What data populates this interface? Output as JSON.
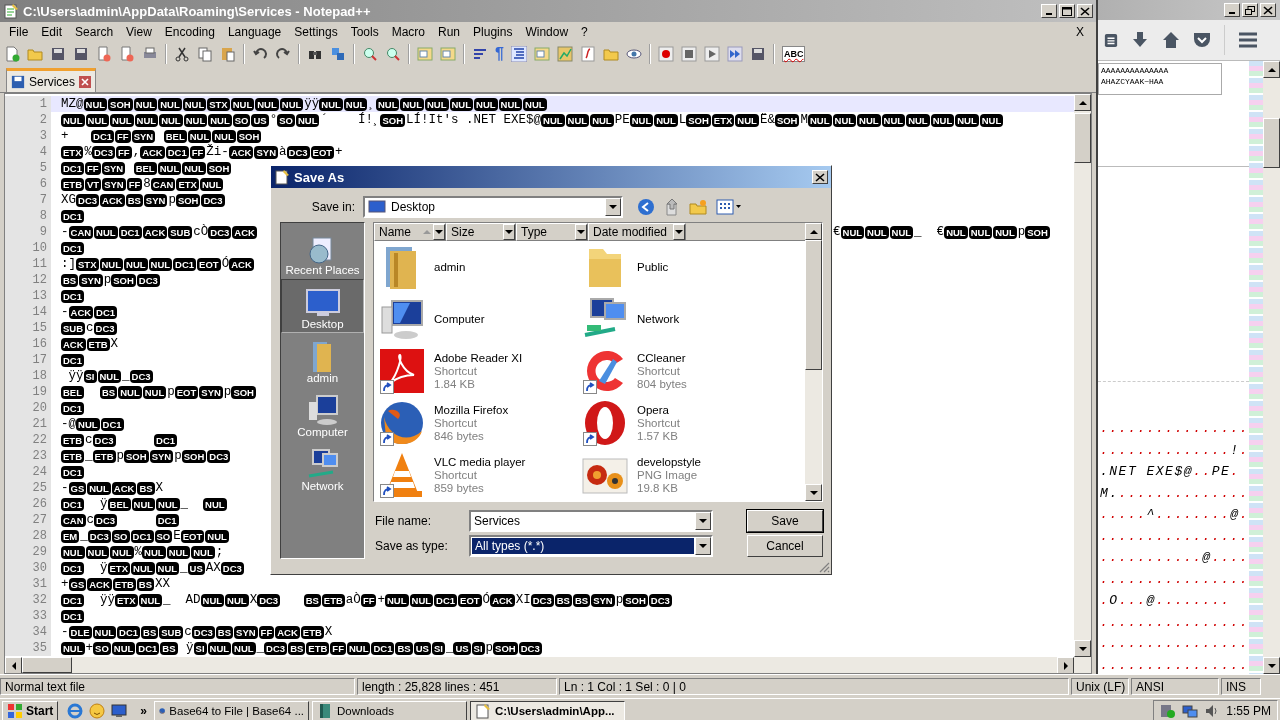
{
  "notepad": {
    "title": "C:\\Users\\admin\\AppData\\Roaming\\Services - Notepad++",
    "active": false,
    "menu": [
      "File",
      "Edit",
      "Search",
      "View",
      "Encoding",
      "Language",
      "Settings",
      "Tools",
      "Macro",
      "Run",
      "Plugins",
      "Window",
      "?"
    ],
    "menu_close": "X",
    "pilcrow": "¶",
    "spellcheck": "ABC",
    "tabs": [
      {
        "label": "Services",
        "selected": true
      }
    ],
    "lines": [
      {
        "number": "1",
        "current": true,
        "segments": [
          {
            "kind": "text",
            "text": "MZ@"
          },
          {
            "kind": "ctrl",
            "codes": [
              "NUL",
              "SOH",
              "NUL",
              "NUL",
              "NUL",
              "STX",
              "NUL",
              "NUL",
              "NUL"
            ]
          },
          {
            "kind": "text",
            "text": "ÿÿ"
          },
          {
            "kind": "ctrl",
            "codes": [
              "NUL",
              "NUL"
            ]
          },
          {
            "kind": "text",
            "text": "¸"
          },
          {
            "kind": "ctrl",
            "codes": [
              "NUL",
              "NUL",
              "NUL",
              "NUL",
              "NUL",
              "NUL",
              "NUL"
            ]
          }
        ]
      },
      {
        "number": "2",
        "current": false,
        "segments": [
          {
            "kind": "ctrl",
            "codes": [
              "NUL",
              "NUL",
              "NUL",
              "NUL",
              "NUL",
              "NUL",
              "NUL",
              "SO",
              "US"
            ]
          },
          {
            "kind": "text",
            "text": "°"
          },
          {
            "kind": "ctrl",
            "codes": [
              "SO",
              "NUL"
            ]
          },
          {
            "kind": "text",
            "text": "´    Í!¸"
          },
          {
            "kind": "ctrl",
            "codes": [
              "SOH"
            ]
          },
          {
            "kind": "text",
            "text": "LÍ!It's .NET EXE$@"
          },
          {
            "kind": "ctrl",
            "codes": [
              "NUL",
              "NUL",
              "NUL"
            ]
          },
          {
            "kind": "text",
            "text": "PE"
          },
          {
            "kind": "ctrl",
            "codes": [
              "NUL",
              "NUL"
            ]
          },
          {
            "kind": "text",
            "text": "L"
          },
          {
            "kind": "ctrl",
            "codes": [
              "SOH",
              "ETX",
              "NUL"
            ]
          },
          {
            "kind": "text",
            "text": "Ë&"
          },
          {
            "kind": "ctrl",
            "codes": [
              "SOH"
            ]
          },
          {
            "kind": "text",
            "text": "M"
          },
          {
            "kind": "ctrl",
            "codes": [
              "NUL",
              "NUL",
              "NUL",
              "NUL",
              "NUL",
              "NUL",
              "NUL",
              "NUL"
            ]
          }
        ]
      },
      {
        "number": "3",
        "current": false,
        "segments": [
          {
            "kind": "text",
            "text": "+   "
          },
          {
            "kind": "ctrl",
            "codes": [
              "DC1",
              "FF",
              "SYN"
            ]
          },
          {
            "kind": "space"
          },
          {
            "kind": "ctrl",
            "codes": [
              "BEL",
              "NUL",
              "NUL",
              "SOH"
            ]
          }
        ]
      },
      {
        "number": "4",
        "current": false,
        "segments": [
          {
            "kind": "ctrl",
            "codes": [
              "ETX"
            ]
          },
          {
            "kind": "text",
            "text": "%"
          },
          {
            "kind": "ctrl",
            "codes": [
              "DC3",
              "FF"
            ]
          },
          {
            "kind": "text",
            "text": ","
          },
          {
            "kind": "ctrl",
            "codes": [
              "ACK",
              "DC1",
              "FF"
            ]
          },
          {
            "kind": "text",
            "text": "Ži-"
          },
          {
            "kind": "ctrl",
            "codes": [
              "ACK",
              "SYN"
            ]
          },
          {
            "kind": "text",
            "text": "à"
          },
          {
            "kind": "ctrl",
            "codes": [
              "DC3",
              "EOT"
            ]
          },
          {
            "kind": "text",
            "text": "+"
          }
        ]
      },
      {
        "number": "5",
        "current": false,
        "segments": [
          {
            "kind": "ctrl",
            "codes": [
              "DC1",
              "FF",
              "SYN"
            ]
          },
          {
            "kind": "space"
          },
          {
            "kind": "ctrl",
            "codes": [
              "BEL",
              "NUL",
              "NUL",
              "SOH"
            ]
          }
        ]
      },
      {
        "number": "6",
        "current": false,
        "segments": [
          {
            "kind": "ctrl",
            "codes": [
              "ETB",
              "VT",
              "SYN",
              "FF"
            ]
          },
          {
            "kind": "text",
            "text": "8"
          },
          {
            "kind": "ctrl",
            "codes": [
              "CAN",
              "ETX",
              "NUL"
            ]
          }
        ]
      },
      {
        "number": "7",
        "current": false,
        "segments": [
          {
            "kind": "text",
            "text": "XG"
          },
          {
            "kind": "ctrl",
            "codes": [
              "DC3",
              "ACK",
              "BS",
              "SYN"
            ]
          },
          {
            "kind": "text",
            "text": "p"
          },
          {
            "kind": "ctrl",
            "codes": [
              "SOH",
              "DC3"
            ]
          }
        ]
      },
      {
        "number": "8",
        "current": false,
        "segments": [
          {
            "kind": "ctrl",
            "codes": [
              "DC1"
            ]
          }
        ]
      },
      {
        "number": "9",
        "current": false,
        "segments": [
          {
            "kind": "text",
            "text": "-"
          },
          {
            "kind": "ctrl",
            "codes": [
              "CAN",
              "NUL",
              "DC1",
              "ACK",
              "SUB"
            ]
          },
          {
            "kind": "text",
            "text": "cÒ"
          },
          {
            "kind": "ctrl",
            "codes": [
              "DC3",
              "ACK"
            ]
          }
        ],
        "right_segments": [
          {
            "kind": "text",
            "text": "€"
          },
          {
            "kind": "ctrl",
            "codes": [
              "NUL",
              "NUL",
              "NUL"
            ]
          },
          {
            "kind": "text",
            "text": "_  €"
          },
          {
            "kind": "ctrl",
            "codes": [
              "NUL",
              "NUL",
              "NUL"
            ]
          },
          {
            "kind": "text",
            "text": "p"
          },
          {
            "kind": "ctrl",
            "codes": [
              "SOH"
            ]
          }
        ]
      },
      {
        "number": "10",
        "current": false,
        "segments": [
          {
            "kind": "ctrl",
            "codes": [
              "DC1"
            ]
          }
        ]
      },
      {
        "number": "11",
        "current": false,
        "segments": [
          {
            "kind": "text",
            "text": ":]"
          },
          {
            "kind": "ctrl",
            "codes": [
              "STX",
              "NUL",
              "NUL",
              "NUL",
              "DC1",
              "EOT"
            ]
          },
          {
            "kind": "text",
            "text": "Ó"
          },
          {
            "kind": "ctrl",
            "codes": [
              "ACK"
            ]
          }
        ]
      },
      {
        "number": "12",
        "current": false,
        "segments": [
          {
            "kind": "ctrl",
            "codes": [
              "BS",
              "SYN"
            ]
          },
          {
            "kind": "text",
            "text": "p"
          },
          {
            "kind": "ctrl",
            "codes": [
              "SOH",
              "DC3"
            ]
          }
        ]
      },
      {
        "number": "13",
        "current": false,
        "segments": [
          {
            "kind": "ctrl",
            "codes": [
              "DC1"
            ]
          }
        ]
      },
      {
        "number": "14",
        "current": false,
        "segments": [
          {
            "kind": "text",
            "text": "-"
          },
          {
            "kind": "ctrl",
            "codes": [
              "ACK",
              "DC1"
            ]
          }
        ]
      },
      {
        "number": "15",
        "current": false,
        "segments": [
          {
            "kind": "ctrl",
            "codes": [
              "SUB"
            ]
          },
          {
            "kind": "text",
            "text": "c"
          },
          {
            "kind": "ctrl",
            "codes": [
              "DC3"
            ]
          }
        ]
      },
      {
        "number": "16",
        "current": false,
        "segments": [
          {
            "kind": "ctrl",
            "codes": [
              "ACK",
              "ETB"
            ]
          },
          {
            "kind": "text",
            "text": "X"
          }
        ]
      },
      {
        "number": "17",
        "current": false,
        "segments": [
          {
            "kind": "ctrl",
            "codes": [
              "DC1"
            ]
          }
        ]
      },
      {
        "number": "18",
        "current": false,
        "segments": [
          {
            "kind": "text",
            "text": " ÿÿ"
          },
          {
            "kind": "ctrl",
            "codes": [
              "SI",
              "NUL"
            ]
          },
          {
            "kind": "text",
            "text": "_"
          },
          {
            "kind": "ctrl",
            "codes": [
              "DC3"
            ]
          }
        ]
      },
      {
        "number": "19",
        "current": false,
        "segments": [
          {
            "kind": "ctrl",
            "codes": [
              "BEL"
            ]
          },
          {
            "kind": "space"
          },
          {
            "kind": "space"
          },
          {
            "kind": "ctrl",
            "codes": [
              "BS",
              "NUL",
              "NUL"
            ]
          },
          {
            "kind": "text",
            "text": "p"
          },
          {
            "kind": "ctrl",
            "codes": [
              "EOT",
              "SYN"
            ]
          },
          {
            "kind": "text",
            "text": "p"
          },
          {
            "kind": "ctrl",
            "codes": [
              "SOH"
            ]
          }
        ]
      },
      {
        "number": "20",
        "current": false,
        "segments": [
          {
            "kind": "ctrl",
            "codes": [
              "DC1"
            ]
          }
        ]
      },
      {
        "number": "21",
        "current": false,
        "segments": [
          {
            "kind": "text",
            "text": "-@"
          },
          {
            "kind": "ctrl",
            "codes": [
              "NUL",
              "DC1"
            ]
          }
        ]
      },
      {
        "number": "22",
        "current": false,
        "segments": [
          {
            "kind": "ctrl",
            "codes": [
              "ETB"
            ]
          },
          {
            "kind": "text",
            "text": "c"
          },
          {
            "kind": "ctrl",
            "codes": [
              "DC3"
            ]
          },
          {
            "kind": "space"
          },
          {
            "kind": "space"
          },
          {
            "kind": "space"
          },
          {
            "kind": "space"
          },
          {
            "kind": "space"
          },
          {
            "kind": "ctrl",
            "codes": [
              "DC1"
            ]
          }
        ]
      },
      {
        "number": "23",
        "current": false,
        "segments": [
          {
            "kind": "ctrl",
            "codes": [
              "ETB"
            ]
          },
          {
            "kind": "text",
            "text": "_"
          },
          {
            "kind": "ctrl",
            "codes": [
              "ETB"
            ]
          },
          {
            "kind": "text",
            "text": "p"
          },
          {
            "kind": "ctrl",
            "codes": [
              "SOH",
              "SYN"
            ]
          },
          {
            "kind": "text",
            "text": "p"
          },
          {
            "kind": "ctrl",
            "codes": [
              "SOH",
              "DC3"
            ]
          }
        ]
      },
      {
        "number": "24",
        "current": false,
        "segments": [
          {
            "kind": "ctrl",
            "codes": [
              "DC1"
            ]
          }
        ]
      },
      {
        "number": "25",
        "current": false,
        "segments": [
          {
            "kind": "text",
            "text": "-"
          },
          {
            "kind": "ctrl",
            "codes": [
              "GS",
              "NUL",
              "ACK",
              "BS"
            ]
          },
          {
            "kind": "text",
            "text": "X"
          }
        ]
      },
      {
        "number": "26",
        "current": false,
        "segments": [
          {
            "kind": "ctrl",
            "codes": [
              "DC1"
            ]
          },
          {
            "kind": "text",
            "text": "  ÿ"
          },
          {
            "kind": "ctrl",
            "codes": [
              "BEL",
              "NUL",
              "NUL"
            ]
          },
          {
            "kind": "text",
            "text": "_  "
          },
          {
            "kind": "ctrl",
            "codes": [
              "NUL"
            ]
          }
        ]
      },
      {
        "number": "27",
        "current": false,
        "segments": [
          {
            "kind": "ctrl",
            "codes": [
              "CAN"
            ]
          },
          {
            "kind": "text",
            "text": "c"
          },
          {
            "kind": "ctrl",
            "codes": [
              "DC3"
            ]
          },
          {
            "kind": "space"
          },
          {
            "kind": "space"
          },
          {
            "kind": "space"
          },
          {
            "kind": "space"
          },
          {
            "kind": "space"
          },
          {
            "kind": "ctrl",
            "codes": [
              "DC1"
            ]
          }
        ]
      },
      {
        "number": "28",
        "current": false,
        "segments": [
          {
            "kind": "ctrl",
            "codes": [
              "EM"
            ]
          },
          {
            "kind": "text",
            "text": "_"
          },
          {
            "kind": "ctrl",
            "codes": [
              "DC3",
              "SO",
              "DC1",
              "SO"
            ]
          },
          {
            "kind": "text",
            "text": "E"
          },
          {
            "kind": "ctrl",
            "codes": [
              "EOT",
              "NUL"
            ]
          }
        ]
      },
      {
        "number": "29",
        "current": false,
        "segments": [
          {
            "kind": "ctrl",
            "codes": [
              "NUL",
              "NUL",
              "NUL"
            ]
          },
          {
            "kind": "text",
            "text": "%"
          },
          {
            "kind": "ctrl",
            "codes": [
              "NUL",
              "NUL",
              "NUL"
            ]
          },
          {
            "kind": "text",
            "text": ";"
          }
        ]
      },
      {
        "number": "30",
        "current": false,
        "segments": [
          {
            "kind": "ctrl",
            "codes": [
              "DC1"
            ]
          },
          {
            "kind": "text",
            "text": "  ÿ"
          },
          {
            "kind": "ctrl",
            "codes": [
              "ETX",
              "NUL",
              "NUL"
            ]
          },
          {
            "kind": "text",
            "text": "_"
          },
          {
            "kind": "ctrl",
            "codes": [
              "US"
            ]
          },
          {
            "kind": "text",
            "text": "AX"
          },
          {
            "kind": "ctrl",
            "codes": [
              "DC3"
            ]
          }
        ]
      },
      {
        "number": "31",
        "current": false,
        "segments": [
          {
            "kind": "text",
            "text": "+"
          },
          {
            "kind": "ctrl",
            "codes": [
              "GS",
              "ACK",
              "ETB",
              "BS"
            ]
          },
          {
            "kind": "text",
            "text": "XX"
          }
        ]
      },
      {
        "number": "32",
        "current": false,
        "segments": [
          {
            "kind": "ctrl",
            "codes": [
              "DC1"
            ]
          },
          {
            "kind": "text",
            "text": "  ÿÿ"
          },
          {
            "kind": "ctrl",
            "codes": [
              "ETX",
              "NUL"
            ]
          },
          {
            "kind": "text",
            "text": "_  AD"
          },
          {
            "kind": "ctrl",
            "codes": [
              "NUL",
              "NUL"
            ]
          },
          {
            "kind": "text",
            "text": "X"
          },
          {
            "kind": "ctrl",
            "codes": [
              "DC3"
            ]
          },
          {
            "kind": "space"
          },
          {
            "kind": "space"
          },
          {
            "kind": "space"
          },
          {
            "kind": "ctrl",
            "codes": [
              "BS",
              "ETB"
            ]
          },
          {
            "kind": "text",
            "text": "aÒ"
          },
          {
            "kind": "ctrl",
            "codes": [
              "FF"
            ]
          },
          {
            "kind": "text",
            "text": "+"
          },
          {
            "kind": "ctrl",
            "codes": [
              "NUL",
              "NUL",
              "DC1",
              "EOT"
            ]
          },
          {
            "kind": "text",
            "text": "Ó"
          },
          {
            "kind": "ctrl",
            "codes": [
              "ACK"
            ]
          },
          {
            "kind": "text",
            "text": "XI"
          },
          {
            "kind": "ctrl",
            "codes": [
              "DC3",
              "BS",
              "BS",
              "SYN"
            ]
          },
          {
            "kind": "text",
            "text": "p"
          },
          {
            "kind": "ctrl",
            "codes": [
              "SOH",
              "DC3"
            ]
          }
        ]
      },
      {
        "number": "33",
        "current": false,
        "segments": [
          {
            "kind": "ctrl",
            "codes": [
              "DC1"
            ]
          }
        ]
      },
      {
        "number": "34",
        "current": false,
        "segments": [
          {
            "kind": "text",
            "text": "-"
          },
          {
            "kind": "ctrl",
            "codes": [
              "DLE",
              "NUL",
              "DC1",
              "BS",
              "SUB"
            ]
          },
          {
            "kind": "text",
            "text": "c"
          },
          {
            "kind": "ctrl",
            "codes": [
              "DC3",
              "BS",
              "SYN",
              "FF",
              "ACK",
              "ETB"
            ]
          },
          {
            "kind": "text",
            "text": "X"
          }
        ]
      },
      {
        "number": "35",
        "current": false,
        "segments": [
          {
            "kind": "ctrl",
            "codes": [
              "NUL"
            ]
          },
          {
            "kind": "text",
            "text": "+"
          },
          {
            "kind": "ctrl",
            "codes": [
              "SO",
              "NUL",
              "DC1",
              "BS"
            ]
          },
          {
            "kind": "text",
            "text": " ÿ"
          },
          {
            "kind": "ctrl",
            "codes": [
              "SI",
              "NUL",
              "NUL"
            ]
          },
          {
            "kind": "text",
            "text": "_"
          },
          {
            "kind": "ctrl",
            "codes": [
              "DC3",
              "BS",
              "ETB",
              "FF",
              "NUL",
              "DC1",
              "BS",
              "US",
              "SI"
            ]
          },
          {
            "kind": "text",
            "text": "_"
          },
          {
            "kind": "ctrl",
            "codes": [
              "US",
              "SI"
            ]
          },
          {
            "kind": "text",
            "text": "p"
          },
          {
            "kind": "ctrl",
            "codes": [
              "SOH",
              "DC3"
            ]
          }
        ]
      }
    ]
  },
  "save_dialog": {
    "title": "Save As",
    "active": true,
    "save_in_label": "Save in:",
    "save_in": "Desktop",
    "places": [
      {
        "label": "Recent Places",
        "selected": false
      },
      {
        "label": "Desktop",
        "selected": true
      },
      {
        "label": "admin",
        "selected": false
      },
      {
        "label": "Computer",
        "selected": false
      },
      {
        "label": "Network",
        "selected": false
      }
    ],
    "columns": [
      {
        "label": "Name",
        "sorted": true
      },
      {
        "label": "Size",
        "sorted": false
      },
      {
        "label": "Type",
        "sorted": false
      },
      {
        "label": "Date modified",
        "sorted": false
      }
    ],
    "items": [
      {
        "name": "admin",
        "shortcut": false
      },
      {
        "name": "Public",
        "shortcut": false
      },
      {
        "name": "Computer",
        "shortcut": false
      },
      {
        "name": "Network",
        "shortcut": false
      },
      {
        "name": "Adobe Reader XI",
        "type": "Shortcut",
        "size": "1.84 KB",
        "shortcut": true
      },
      {
        "name": "CCleaner",
        "type": "Shortcut",
        "size": "804 bytes",
        "shortcut": true
      },
      {
        "name": "Mozilla Firefox",
        "type": "Shortcut",
        "size": "846 bytes",
        "shortcut": true
      },
      {
        "name": "Opera",
        "type": "Shortcut",
        "size": "1.57 KB",
        "shortcut": true
      },
      {
        "name": "VLC media player",
        "type": "Shortcut",
        "size": "859 bytes",
        "shortcut": true
      },
      {
        "name": "developstyle",
        "type": "PNG Image",
        "size": "19.8 KB",
        "shortcut": false
      }
    ],
    "file_name_label": "File name:",
    "file_name": "Services",
    "type_label": "Save as type:",
    "type": {
      "value": "All types (*.*)",
      "selected": true
    },
    "buttons": [
      "Save",
      "Cancel"
    ]
  },
  "browser": {
    "box_lines": [
      "AAAAAAAAAAAAAA",
      "AHAZCYAAK~HAA"
    ],
    "hex_rows": [
      [
        {
          "kind": "dots",
          "text": "................"
        }
      ],
      [
        {
          "kind": "dots",
          "text": ".............."
        },
        {
          "kind": "text",
          "text": "!"
        },
        {
          "kind": "dots",
          "text": "."
        }
      ],
      [
        {
          "kind": "text",
          "text": ".NET EXE$@"
        },
        {
          "kind": "dots",
          "text": ".."
        },
        {
          "kind": "text",
          "text": "PE"
        },
        {
          "kind": "dots",
          "text": "."
        }
      ],
      [
        {
          "kind": "text",
          "text": "M."
        },
        {
          "kind": "dots",
          "text": ".............."
        }
      ],
      [
        {
          "kind": "dots",
          "text": "....."
        },
        {
          "kind": "text",
          "text": "^"
        },
        {
          "kind": "dots",
          "text": "........"
        },
        {
          "kind": "text",
          "text": "@"
        },
        {
          "kind": "dots",
          "text": "."
        }
      ],
      [
        {
          "kind": "dots",
          "text": "................"
        }
      ],
      [
        {
          "kind": "dots",
          "text": "..........."
        },
        {
          "kind": "text",
          "text": "@"
        },
        {
          "kind": "dots",
          "text": "...."
        }
      ],
      [
        {
          "kind": "dots",
          "text": "................"
        }
      ],
      [
        {
          "kind": "dots",
          "text": "."
        },
        {
          "kind": "text",
          "text": "O"
        },
        {
          "kind": "dots",
          "text": "..."
        },
        {
          "kind": "text",
          "text": "@"
        },
        {
          "kind": "dots",
          "text": "........"
        }
      ],
      [
        {
          "kind": "dots",
          "text": "................"
        }
      ],
      [
        {
          "kind": "dots",
          "text": "................"
        }
      ],
      [
        {
          "kind": "dots",
          "text": "................"
        }
      ]
    ]
  },
  "status_bar": {
    "doc_type": "Normal text file",
    "length": "length : 25,828    lines : 451",
    "position": "Ln : 1    Col : 1    Sel : 0 | 0",
    "eol": "Unix (LF)",
    "encoding": "ANSI",
    "mode": "INS"
  },
  "taskbar": {
    "start": "Start",
    "more": "»",
    "tasks": [
      {
        "label": "Base64 to File | Base64 ...",
        "selected": false
      },
      {
        "label": "Downloads",
        "selected": false
      },
      {
        "label": "C:\\Users\\admin\\App...",
        "selected": true
      }
    ],
    "clock": "1:55 PM"
  }
}
